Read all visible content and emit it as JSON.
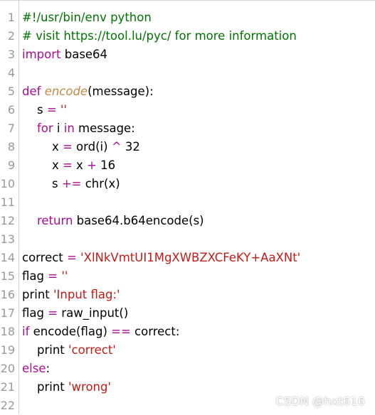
{
  "editor": {
    "lines": [
      {
        "n": "1",
        "tokens": [
          {
            "t": "#!/usr/bin/env python",
            "c": "comment"
          }
        ]
      },
      {
        "n": "2",
        "tokens": [
          {
            "t": "# visit https://tool.lu/pyc/ for more information",
            "c": "comment"
          }
        ]
      },
      {
        "n": "3",
        "tokens": [
          {
            "t": "import",
            "c": "keyword"
          },
          {
            "t": " base64",
            "c": "plain"
          }
        ]
      },
      {
        "n": "4",
        "tokens": []
      },
      {
        "n": "5",
        "tokens": [
          {
            "t": "def",
            "c": "keyword"
          },
          {
            "t": " ",
            "c": "plain"
          },
          {
            "t": "encode",
            "c": "def"
          },
          {
            "t": "(message):",
            "c": "plain"
          }
        ]
      },
      {
        "n": "6",
        "tokens": [
          {
            "t": "    s ",
            "c": "plain"
          },
          {
            "t": "=",
            "c": "op"
          },
          {
            "t": " ",
            "c": "plain"
          },
          {
            "t": "''",
            "c": "string"
          }
        ]
      },
      {
        "n": "7",
        "tokens": [
          {
            "t": "    ",
            "c": "plain"
          },
          {
            "t": "for",
            "c": "keyword"
          },
          {
            "t": " i ",
            "c": "plain"
          },
          {
            "t": "in",
            "c": "keyword"
          },
          {
            "t": " message:",
            "c": "plain"
          }
        ]
      },
      {
        "n": "8",
        "tokens": [
          {
            "t": "        x ",
            "c": "plain"
          },
          {
            "t": "=",
            "c": "op"
          },
          {
            "t": " ord(i) ",
            "c": "plain"
          },
          {
            "t": "^",
            "c": "op"
          },
          {
            "t": " 32",
            "c": "plain"
          }
        ]
      },
      {
        "n": "9",
        "tokens": [
          {
            "t": "        x ",
            "c": "plain"
          },
          {
            "t": "=",
            "c": "op"
          },
          {
            "t": " x ",
            "c": "plain"
          },
          {
            "t": "+",
            "c": "op"
          },
          {
            "t": " 16",
            "c": "plain"
          }
        ]
      },
      {
        "n": "10",
        "tokens": [
          {
            "t": "        s ",
            "c": "plain"
          },
          {
            "t": "+=",
            "c": "op"
          },
          {
            "t": " chr(x)",
            "c": "plain"
          }
        ]
      },
      {
        "n": "11",
        "tokens": []
      },
      {
        "n": "12",
        "tokens": [
          {
            "t": "    ",
            "c": "plain"
          },
          {
            "t": "return",
            "c": "keyword"
          },
          {
            "t": " base64.b64encode(s)",
            "c": "plain"
          }
        ]
      },
      {
        "n": "13",
        "tokens": []
      },
      {
        "n": "14",
        "tokens": [
          {
            "t": "correct ",
            "c": "plain"
          },
          {
            "t": "=",
            "c": "op"
          },
          {
            "t": " ",
            "c": "plain"
          },
          {
            "t": "'XlNkVmtUI1MgXWBZXCFeKY+AaXNt'",
            "c": "string"
          }
        ]
      },
      {
        "n": "15",
        "tokens": [
          {
            "t": "flag ",
            "c": "plain"
          },
          {
            "t": "=",
            "c": "op"
          },
          {
            "t": " ",
            "c": "plain"
          },
          {
            "t": "''",
            "c": "string"
          }
        ]
      },
      {
        "n": "16",
        "tokens": [
          {
            "t": "print ",
            "c": "plain"
          },
          {
            "t": "'Input flag:'",
            "c": "string"
          }
        ]
      },
      {
        "n": "17",
        "tokens": [
          {
            "t": "flag ",
            "c": "plain"
          },
          {
            "t": "=",
            "c": "op"
          },
          {
            "t": " raw_input()",
            "c": "plain"
          }
        ]
      },
      {
        "n": "18",
        "tokens": [
          {
            "t": "if",
            "c": "keyword"
          },
          {
            "t": " encode(flag) ",
            "c": "plain"
          },
          {
            "t": "==",
            "c": "op"
          },
          {
            "t": " correct:",
            "c": "plain"
          }
        ]
      },
      {
        "n": "19",
        "tokens": [
          {
            "t": "    print ",
            "c": "plain"
          },
          {
            "t": "'correct'",
            "c": "string"
          }
        ]
      },
      {
        "n": "20",
        "tokens": [
          {
            "t": "else",
            "c": "keyword"
          },
          {
            "t": ":",
            "c": "plain"
          }
        ]
      },
      {
        "n": "21",
        "tokens": [
          {
            "t": "    print ",
            "c": "plain"
          },
          {
            "t": "'wrong'",
            "c": "string"
          }
        ]
      },
      {
        "n": "22",
        "tokens": []
      }
    ]
  },
  "watermark": "CSDN @hxt616",
  "colors": {
    "comment": "#007400",
    "keyword": "#a90d91",
    "string": "#c41a16",
    "def": "#c48a4a",
    "line_number": "#999999"
  }
}
